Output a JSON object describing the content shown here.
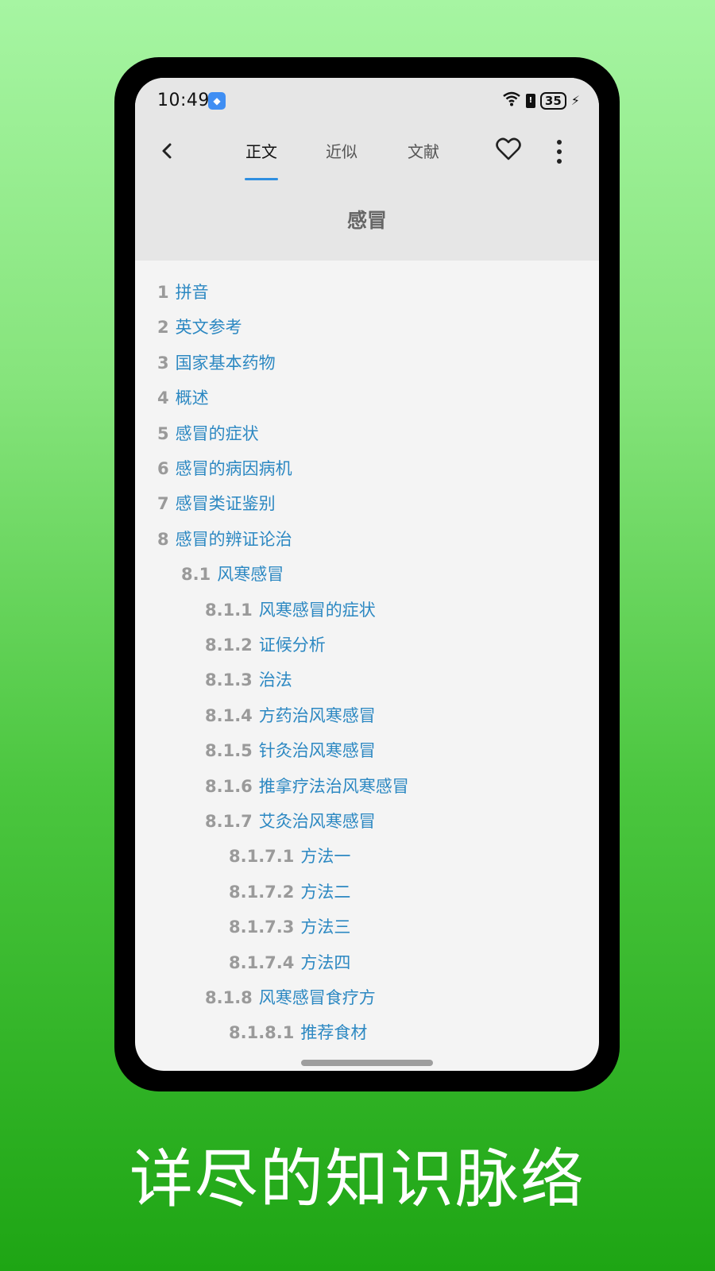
{
  "status_bar": {
    "time": "10:49",
    "battery": "35"
  },
  "header": {
    "tabs": [
      {
        "label": "正文",
        "active": true
      },
      {
        "label": "近似",
        "active": false
      },
      {
        "label": "文献",
        "active": false
      }
    ],
    "title": "感冒"
  },
  "toc": [
    {
      "num": "1",
      "label": "拼音",
      "level": 0
    },
    {
      "num": "2",
      "label": "英文参考",
      "level": 0
    },
    {
      "num": "3",
      "label": "国家基本药物",
      "level": 0
    },
    {
      "num": "4",
      "label": "概述",
      "level": 0
    },
    {
      "num": "5",
      "label": "感冒的症状",
      "level": 0
    },
    {
      "num": "6",
      "label": "感冒的病因病机",
      "level": 0
    },
    {
      "num": "7",
      "label": "感冒类证鉴别",
      "level": 0
    },
    {
      "num": "8",
      "label": "感冒的辨证论治",
      "level": 0
    },
    {
      "num": "8.1",
      "label": "风寒感冒",
      "level": 1
    },
    {
      "num": "8.1.1",
      "label": "风寒感冒的症状",
      "level": 2
    },
    {
      "num": "8.1.2",
      "label": "证候分析",
      "level": 2
    },
    {
      "num": "8.1.3",
      "label": "治法",
      "level": 2
    },
    {
      "num": "8.1.4",
      "label": "方药治风寒感冒",
      "level": 2
    },
    {
      "num": "8.1.5",
      "label": "针灸治风寒感冒",
      "level": 2
    },
    {
      "num": "8.1.6",
      "label": "推拿疗法治风寒感冒",
      "level": 2
    },
    {
      "num": "8.1.7",
      "label": "艾灸治风寒感冒",
      "level": 2
    },
    {
      "num": "8.1.7.1",
      "label": "方法一",
      "level": 3
    },
    {
      "num": "8.1.7.2",
      "label": "方法二",
      "level": 3
    },
    {
      "num": "8.1.7.3",
      "label": "方法三",
      "level": 3
    },
    {
      "num": "8.1.7.4",
      "label": "方法四",
      "level": 3
    },
    {
      "num": "8.1.8",
      "label": "风寒感冒食疗方",
      "level": 2
    },
    {
      "num": "8.1.8.1",
      "label": "推荐食材",
      "level": 3
    }
  ],
  "caption": "详尽的知识脉络",
  "colors": {
    "accent": "#2f8fe0",
    "link": "#2c88c2",
    "number": "#9a9a9a"
  },
  "icons": [
    "back-arrow-icon",
    "heart-icon",
    "more-vert-icon",
    "wifi-icon",
    "battery-icon"
  ]
}
